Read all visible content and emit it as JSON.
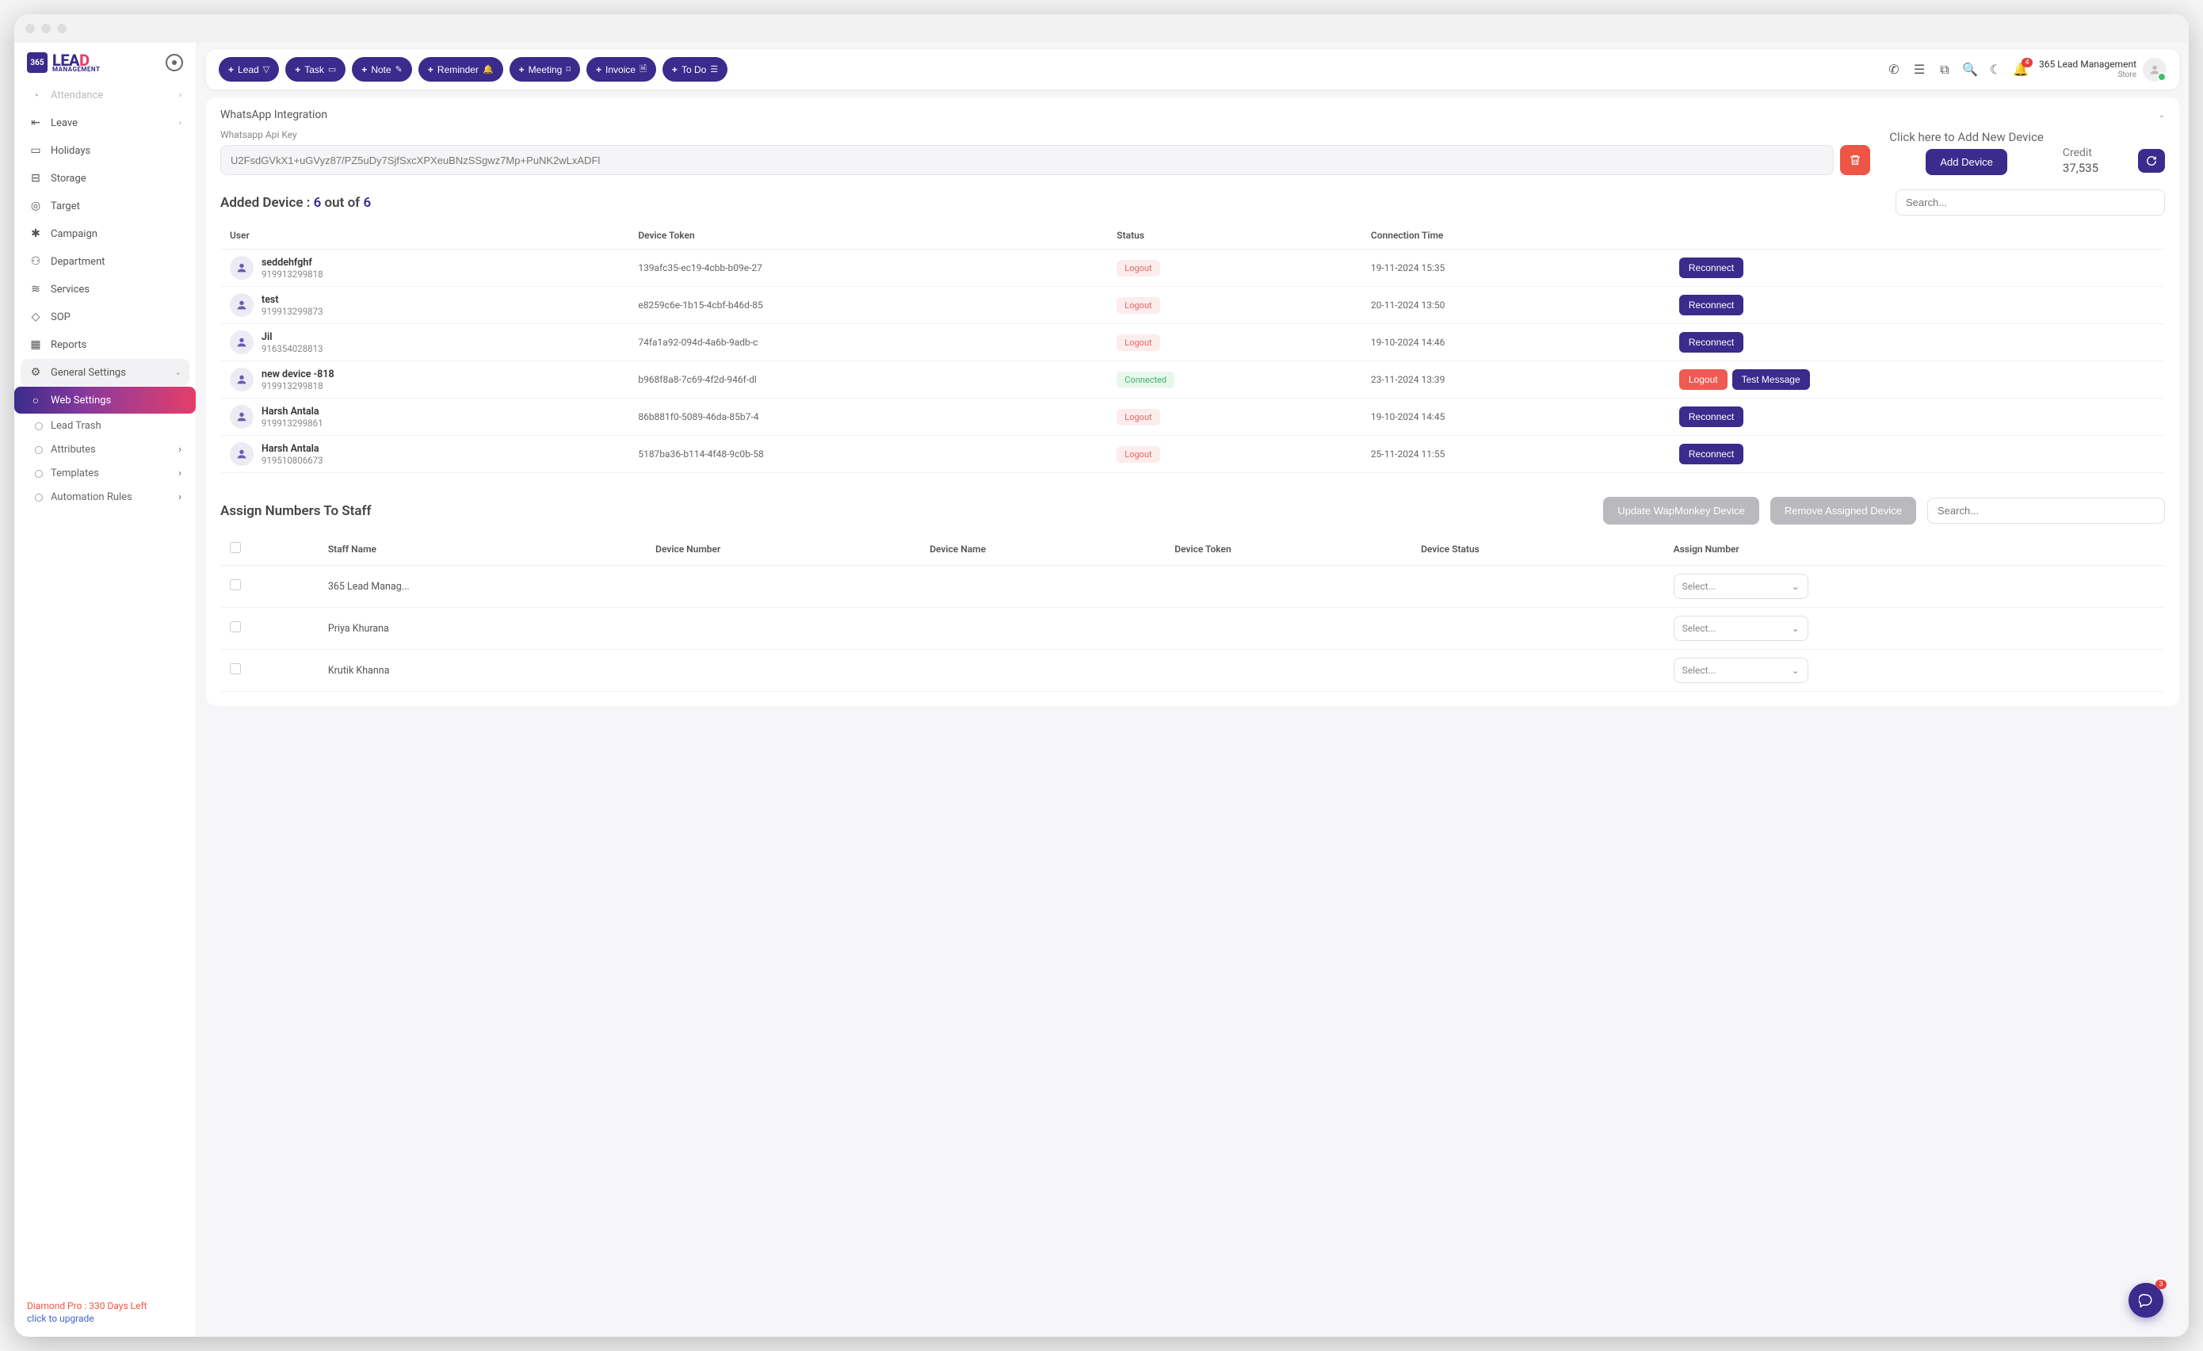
{
  "logo": {
    "mark": "365",
    "main_b": "LEA",
    "main_accent": "D",
    "sub": "MANAGEMENT"
  },
  "sidebar": {
    "items": [
      {
        "label": "Attendance",
        "icon": "attendance-icon",
        "chev": "›",
        "faded": true
      },
      {
        "label": "Leave",
        "icon": "leave-icon",
        "chev": "›"
      },
      {
        "label": "Holidays",
        "icon": "holidays-icon"
      },
      {
        "label": "Storage",
        "icon": "storage-icon"
      },
      {
        "label": "Target",
        "icon": "target-icon"
      },
      {
        "label": "Campaign",
        "icon": "campaign-icon"
      },
      {
        "label": "Department",
        "icon": "department-icon"
      },
      {
        "label": "Services",
        "icon": "services-icon"
      },
      {
        "label": "SOP",
        "icon": "sop-icon"
      },
      {
        "label": "Reports",
        "icon": "reports-icon"
      },
      {
        "label": "General Settings",
        "icon": "settings-icon",
        "chev": "⌄",
        "expanded": true
      },
      {
        "label": "Web Settings",
        "icon": "web-settings-icon",
        "active": true
      },
      {
        "label": "Lead Trash",
        "sub": true
      },
      {
        "label": "Attributes",
        "sub": true,
        "chev": "›"
      },
      {
        "label": "Templates",
        "sub": true,
        "chev": "›"
      },
      {
        "label": "Automation Rules",
        "sub": true,
        "chev": "›"
      }
    ],
    "footer": {
      "plan": "Diamond Pro : 330 Days Left",
      "upgrade": "click to upgrade"
    }
  },
  "topbar": {
    "pills": [
      {
        "label": "Lead",
        "suffix_icon": "filter-icon"
      },
      {
        "label": "Task",
        "suffix_icon": "calendar-icon"
      },
      {
        "label": "Note",
        "suffix_icon": "edit-icon"
      },
      {
        "label": "Reminder",
        "suffix_icon": "bell-icon"
      },
      {
        "label": "Meeting",
        "suffix_icon": "briefcase-icon"
      },
      {
        "label": "Invoice",
        "suffix_icon": "doc-icon"
      },
      {
        "label": "To Do",
        "suffix_icon": "checklist-icon"
      }
    ],
    "icons": [
      "phone-icon",
      "task-list-icon",
      "copy-icon",
      "search-icon",
      "moon-icon",
      "bell-icon"
    ],
    "notif_count": "4",
    "user_name": "365 Lead Management",
    "user_role": "Store"
  },
  "panel": {
    "title": "WhatsApp Integration",
    "api_label": "Whatsapp Api Key",
    "api_value": "U2FsdGVkX1+uGVyz87/PZ5uDy7SjfSxcXPXeuBNzSSgwz7Mp+PuNK2wLxADFl",
    "add_hint": "Click here to Add New Device",
    "add_btn": "Add Device",
    "credit_label": "Credit",
    "credit_value": "37,535"
  },
  "devices": {
    "title_prefix": "Added Device : ",
    "count": "6",
    "of_word": " out of ",
    "total": "6",
    "search_placeholder": "Search...",
    "columns": [
      "User",
      "Device Token",
      "Status",
      "Connection Time",
      ""
    ],
    "rows": [
      {
        "name": "seddehfghf",
        "phone": "919913299818",
        "token": "139afc35-ec19-4cbb-b09e-27",
        "status": "Logout",
        "time": "19-11-2024 15:35",
        "actions": [
          "Reconnect"
        ]
      },
      {
        "name": "test",
        "phone": "919913299873",
        "token": "e8259c6e-1b15-4cbf-b46d-85",
        "status": "Logout",
        "time": "20-11-2024 13:50",
        "actions": [
          "Reconnect"
        ]
      },
      {
        "name": "Jil",
        "phone": "916354028813",
        "token": "74fa1a92-094d-4a6b-9adb-c",
        "status": "Logout",
        "time": "19-10-2024 14:46",
        "actions": [
          "Reconnect"
        ]
      },
      {
        "name": "new device  -818",
        "phone": "919913299818",
        "token": "b968f8a8-7c69-4f2d-946f-dl",
        "status": "Connected",
        "time": "23-11-2024 13:39",
        "actions": [
          "Logout",
          "Test Message"
        ]
      },
      {
        "name": "Harsh Antala",
        "phone": "919913299861",
        "token": "86b881f0-5089-46da-85b7-4",
        "status": "Logout",
        "time": "19-10-2024 14:45",
        "actions": [
          "Reconnect"
        ]
      },
      {
        "name": "Harsh Antala",
        "phone": "919510806673",
        "token": "5187ba36-b114-4f48-9c0b-58",
        "status": "Logout",
        "time": "25-11-2024 11:55",
        "actions": [
          "Reconnect"
        ]
      }
    ]
  },
  "assign": {
    "title": "Assign Numbers To Staff",
    "update_btn": "Update WapMonkey Device",
    "remove_btn": "Remove Assigned Device",
    "search_placeholder": "Search...",
    "columns": [
      "",
      "Staff Name",
      "Device Number",
      "Device Name",
      "Device Token",
      "Device Status",
      "Assign Number"
    ],
    "select_placeholder": "Select...",
    "rows": [
      {
        "name": "365 Lead Manag..."
      },
      {
        "name": "Priya Khurana"
      },
      {
        "name": "Krutik Khanna"
      }
    ]
  },
  "fab_badge": "3"
}
